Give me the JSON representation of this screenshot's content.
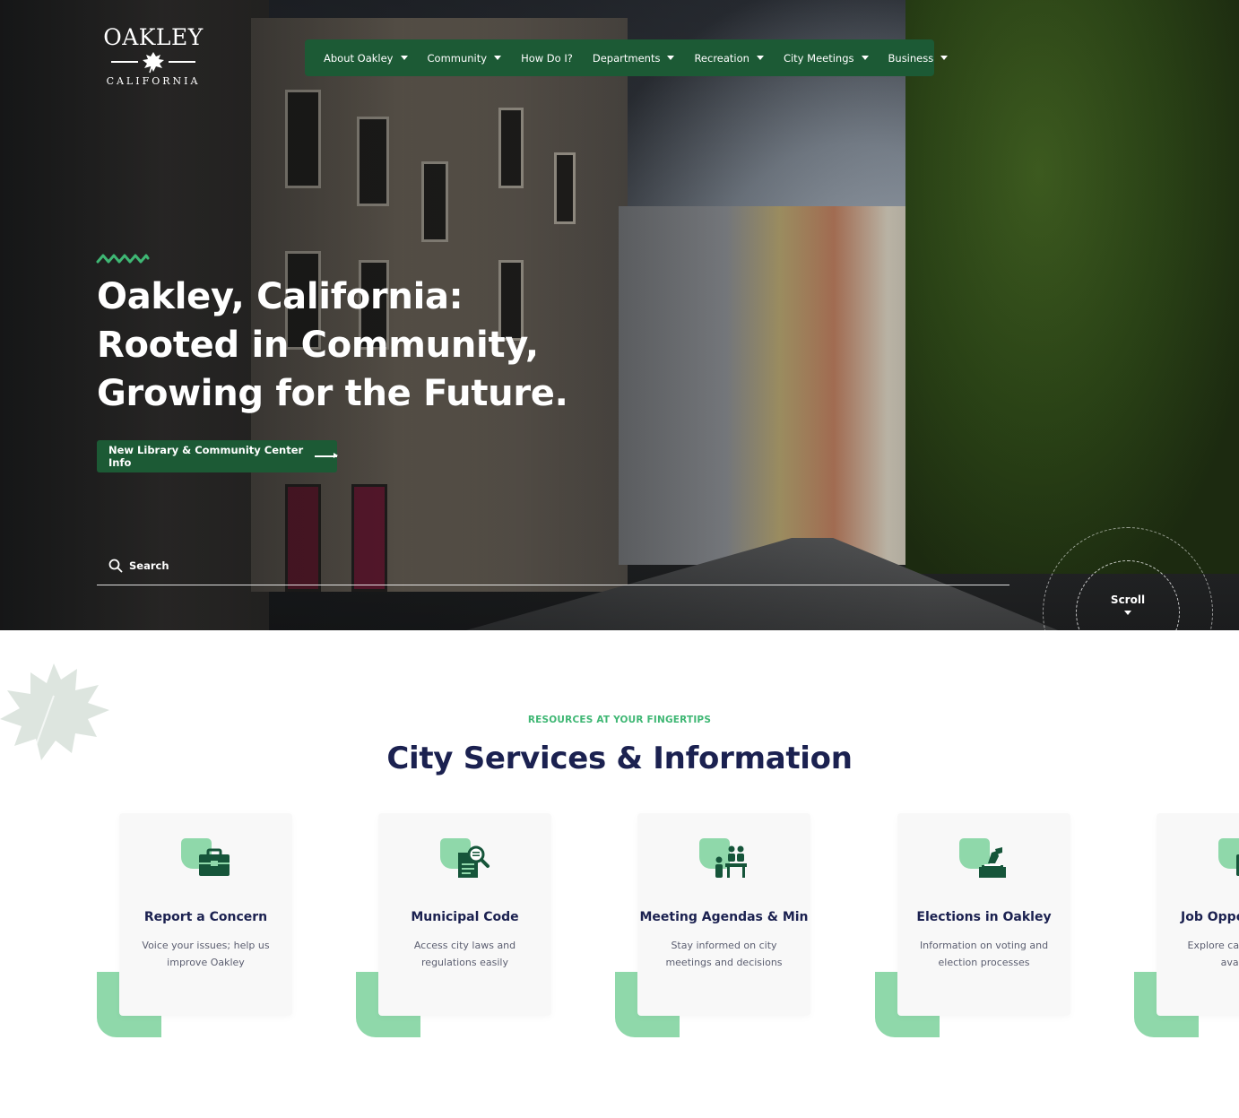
{
  "brand": {
    "name": "OAKLEY",
    "sub": "CALIFORNIA",
    "green": "#1c5a35",
    "accent": "#3fb774",
    "navy": "#1b2150"
  },
  "nav": {
    "items": [
      {
        "label": "About Oakley",
        "dropdown": true
      },
      {
        "label": "Community",
        "dropdown": true
      },
      {
        "label": "How Do I?",
        "dropdown": false
      },
      {
        "label": "Departments",
        "dropdown": true
      },
      {
        "label": "Recreation",
        "dropdown": true
      },
      {
        "label": "City Meetings",
        "dropdown": true
      },
      {
        "label": "Business",
        "dropdown": true
      }
    ]
  },
  "hero": {
    "title_lines": [
      "Oakley, California:",
      "Rooted in Community,",
      "Growing for the Future."
    ],
    "cta_label": "New Library & Community Center Info",
    "search_placeholder": "Search",
    "scroll_label": "Scroll"
  },
  "services": {
    "eyebrow": "RESOURCES AT YOUR FINGERTIPS",
    "title": "City Services & Information",
    "cards": [
      {
        "title": "Report a Concern",
        "desc": "Voice your issues; help us improve Oakley",
        "icon": "briefcase-icon"
      },
      {
        "title": "Municipal Code",
        "desc": "Access city laws and regulations easily",
        "icon": "document-search-icon"
      },
      {
        "title": "Meeting Agendas & Min",
        "desc": "Stay informed on city meetings and decisions",
        "icon": "meeting-people-icon"
      },
      {
        "title": "Elections in Oakley",
        "desc": "Information on voting and election processes",
        "icon": "ballot-box-icon"
      },
      {
        "title": "Job Opportunities",
        "desc": "Explore career options available",
        "icon": "job-icon"
      }
    ]
  }
}
